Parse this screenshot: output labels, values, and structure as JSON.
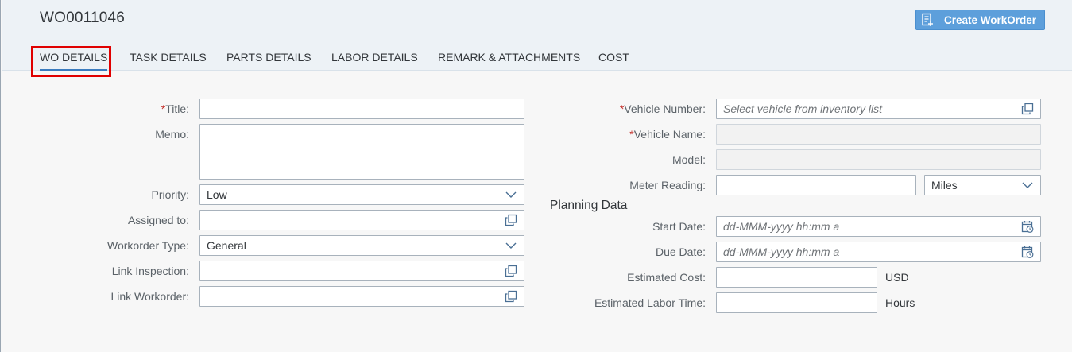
{
  "header": {
    "title": "WO0011046",
    "create_button_label": "Create WorkOrder"
  },
  "tabs": [
    {
      "label": "WO DETAILS",
      "active": true
    },
    {
      "label": "TASK DETAILS"
    },
    {
      "label": "PARTS DETAILS"
    },
    {
      "label": "LABOR DETAILS"
    },
    {
      "label": "REMARK & ATTACHMENTS"
    },
    {
      "label": "COST"
    }
  ],
  "left": {
    "title_label": "Title:",
    "title_value": "",
    "memo_label": "Memo:",
    "memo_value": "",
    "priority_label": "Priority:",
    "priority_value": "Low",
    "assigned_label": "Assigned to:",
    "assigned_value": "",
    "type_label": "Workorder Type:",
    "type_value": "General",
    "inspection_label": "Link Inspection:",
    "inspection_value": "",
    "workorder_label": "Link Workorder:",
    "workorder_value": ""
  },
  "right": {
    "vehicle_number_label": "Vehicle Number:",
    "vehicle_number_placeholder": "Select vehicle from inventory list",
    "vehicle_name_label": "Vehicle Name:",
    "vehicle_name_value": "",
    "model_label": "Model:",
    "model_value": "",
    "meter_label": "Meter Reading:",
    "meter_value": "",
    "meter_unit": "Miles",
    "planning_title": "Planning Data",
    "start_label": "Start Date:",
    "start_placeholder": "dd-MMM-yyyy hh:mm a",
    "due_label": "Due Date:",
    "due_placeholder": "dd-MMM-yyyy hh:mm a",
    "cost_label": "Estimated Cost:",
    "cost_value": "",
    "cost_unit": "USD",
    "labor_label": "Estimated Labor Time:",
    "labor_value": "",
    "labor_unit": "Hours"
  },
  "required_marker": "*",
  "colors": {
    "accent": "#5d9fdb",
    "tab_underline": "#3b7cbf",
    "required": "#c4302b",
    "highlight": "#e00000"
  }
}
